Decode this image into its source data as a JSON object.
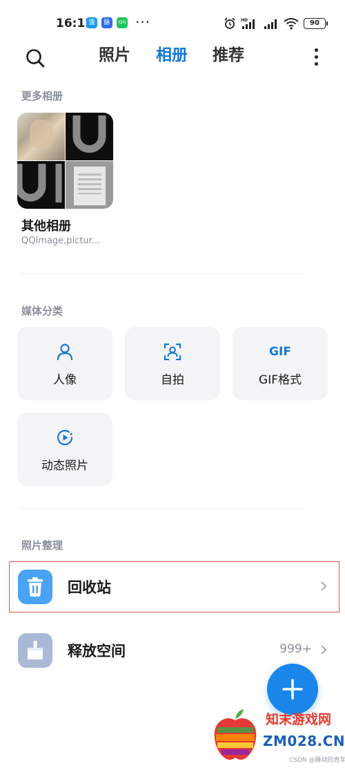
{
  "status_bar": {
    "time": "16:12",
    "badges": [
      "饿",
      "脉",
      "iQIY"
    ],
    "dots": "···",
    "network": "HD",
    "battery": "90"
  },
  "header": {
    "tabs": [
      {
        "label": "照片",
        "active": false
      },
      {
        "label": "相册",
        "active": true
      },
      {
        "label": "推荐",
        "active": false
      }
    ],
    "accent_color": "#1677d6"
  },
  "more_albums": {
    "section_title": "更多相册",
    "album": {
      "name": "其他相册",
      "subtitle": "QQImage,pictur..."
    }
  },
  "media_types": {
    "section_title": "媒体分类",
    "items": [
      {
        "label": "人像",
        "icon": "person-icon"
      },
      {
        "label": "自拍",
        "icon": "selfie-icon"
      },
      {
        "label": "GIF格式",
        "icon": "gif-icon",
        "icon_text": "GIF"
      },
      {
        "label": "动态照片",
        "icon": "motion-photo-icon"
      }
    ]
  },
  "organize": {
    "section_title": "照片整理",
    "items": [
      {
        "label": "回收站",
        "icon": "trash-icon",
        "value": "",
        "icon_color": "#4aa3f5"
      },
      {
        "label": "释放空间",
        "icon": "broom-icon",
        "value": "999+",
        "icon_color": "#a9b9d6"
      }
    ]
  },
  "watermark": {
    "title": "知末游戏网",
    "domain": "ZM028.CN",
    "credit": "CSDN @躁动的青年"
  }
}
